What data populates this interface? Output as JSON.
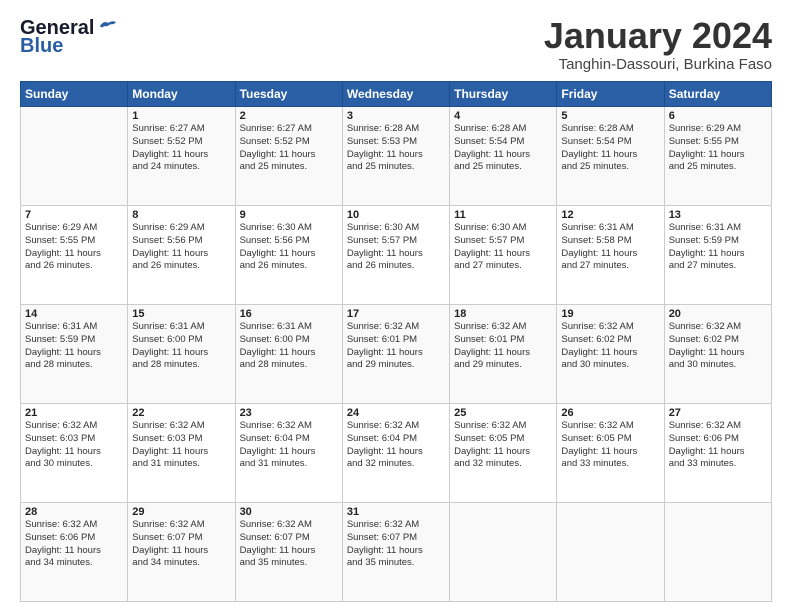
{
  "header": {
    "logo_line1": "General",
    "logo_line2": "Blue",
    "month": "January 2024",
    "location": "Tanghin-Dassouri, Burkina Faso"
  },
  "weekdays": [
    "Sunday",
    "Monday",
    "Tuesday",
    "Wednesday",
    "Thursday",
    "Friday",
    "Saturday"
  ],
  "weeks": [
    [
      {
        "num": "",
        "info": ""
      },
      {
        "num": "1",
        "info": "Sunrise: 6:27 AM\nSunset: 5:52 PM\nDaylight: 11 hours\nand 24 minutes."
      },
      {
        "num": "2",
        "info": "Sunrise: 6:27 AM\nSunset: 5:52 PM\nDaylight: 11 hours\nand 25 minutes."
      },
      {
        "num": "3",
        "info": "Sunrise: 6:28 AM\nSunset: 5:53 PM\nDaylight: 11 hours\nand 25 minutes."
      },
      {
        "num": "4",
        "info": "Sunrise: 6:28 AM\nSunset: 5:54 PM\nDaylight: 11 hours\nand 25 minutes."
      },
      {
        "num": "5",
        "info": "Sunrise: 6:28 AM\nSunset: 5:54 PM\nDaylight: 11 hours\nand 25 minutes."
      },
      {
        "num": "6",
        "info": "Sunrise: 6:29 AM\nSunset: 5:55 PM\nDaylight: 11 hours\nand 25 minutes."
      }
    ],
    [
      {
        "num": "7",
        "info": "Sunrise: 6:29 AM\nSunset: 5:55 PM\nDaylight: 11 hours\nand 26 minutes."
      },
      {
        "num": "8",
        "info": "Sunrise: 6:29 AM\nSunset: 5:56 PM\nDaylight: 11 hours\nand 26 minutes."
      },
      {
        "num": "9",
        "info": "Sunrise: 6:30 AM\nSunset: 5:56 PM\nDaylight: 11 hours\nand 26 minutes."
      },
      {
        "num": "10",
        "info": "Sunrise: 6:30 AM\nSunset: 5:57 PM\nDaylight: 11 hours\nand 26 minutes."
      },
      {
        "num": "11",
        "info": "Sunrise: 6:30 AM\nSunset: 5:57 PM\nDaylight: 11 hours\nand 27 minutes."
      },
      {
        "num": "12",
        "info": "Sunrise: 6:31 AM\nSunset: 5:58 PM\nDaylight: 11 hours\nand 27 minutes."
      },
      {
        "num": "13",
        "info": "Sunrise: 6:31 AM\nSunset: 5:59 PM\nDaylight: 11 hours\nand 27 minutes."
      }
    ],
    [
      {
        "num": "14",
        "info": "Sunrise: 6:31 AM\nSunset: 5:59 PM\nDaylight: 11 hours\nand 28 minutes."
      },
      {
        "num": "15",
        "info": "Sunrise: 6:31 AM\nSunset: 6:00 PM\nDaylight: 11 hours\nand 28 minutes."
      },
      {
        "num": "16",
        "info": "Sunrise: 6:31 AM\nSunset: 6:00 PM\nDaylight: 11 hours\nand 28 minutes."
      },
      {
        "num": "17",
        "info": "Sunrise: 6:32 AM\nSunset: 6:01 PM\nDaylight: 11 hours\nand 29 minutes."
      },
      {
        "num": "18",
        "info": "Sunrise: 6:32 AM\nSunset: 6:01 PM\nDaylight: 11 hours\nand 29 minutes."
      },
      {
        "num": "19",
        "info": "Sunrise: 6:32 AM\nSunset: 6:02 PM\nDaylight: 11 hours\nand 30 minutes."
      },
      {
        "num": "20",
        "info": "Sunrise: 6:32 AM\nSunset: 6:02 PM\nDaylight: 11 hours\nand 30 minutes."
      }
    ],
    [
      {
        "num": "21",
        "info": "Sunrise: 6:32 AM\nSunset: 6:03 PM\nDaylight: 11 hours\nand 30 minutes."
      },
      {
        "num": "22",
        "info": "Sunrise: 6:32 AM\nSunset: 6:03 PM\nDaylight: 11 hours\nand 31 minutes."
      },
      {
        "num": "23",
        "info": "Sunrise: 6:32 AM\nSunset: 6:04 PM\nDaylight: 11 hours\nand 31 minutes."
      },
      {
        "num": "24",
        "info": "Sunrise: 6:32 AM\nSunset: 6:04 PM\nDaylight: 11 hours\nand 32 minutes."
      },
      {
        "num": "25",
        "info": "Sunrise: 6:32 AM\nSunset: 6:05 PM\nDaylight: 11 hours\nand 32 minutes."
      },
      {
        "num": "26",
        "info": "Sunrise: 6:32 AM\nSunset: 6:05 PM\nDaylight: 11 hours\nand 33 minutes."
      },
      {
        "num": "27",
        "info": "Sunrise: 6:32 AM\nSunset: 6:06 PM\nDaylight: 11 hours\nand 33 minutes."
      }
    ],
    [
      {
        "num": "28",
        "info": "Sunrise: 6:32 AM\nSunset: 6:06 PM\nDaylight: 11 hours\nand 34 minutes."
      },
      {
        "num": "29",
        "info": "Sunrise: 6:32 AM\nSunset: 6:07 PM\nDaylight: 11 hours\nand 34 minutes."
      },
      {
        "num": "30",
        "info": "Sunrise: 6:32 AM\nSunset: 6:07 PM\nDaylight: 11 hours\nand 35 minutes."
      },
      {
        "num": "31",
        "info": "Sunrise: 6:32 AM\nSunset: 6:07 PM\nDaylight: 11 hours\nand 35 minutes."
      },
      {
        "num": "",
        "info": ""
      },
      {
        "num": "",
        "info": ""
      },
      {
        "num": "",
        "info": ""
      }
    ]
  ]
}
